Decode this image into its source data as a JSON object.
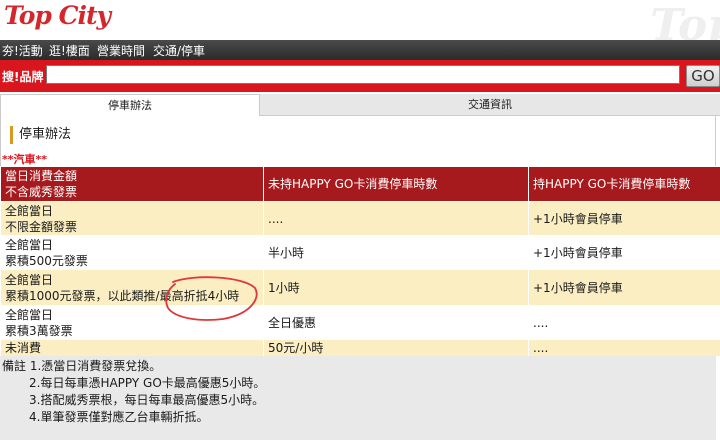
{
  "header": {
    "logo": "Top City",
    "watermark": "Top"
  },
  "nav": {
    "items": [
      "夯!活動",
      "逛!樓面",
      "營業時間",
      "交通/停車"
    ]
  },
  "search": {
    "label": "搜!品牌",
    "value": "",
    "go_label": "GO"
  },
  "tabs": [
    {
      "label": "停車辦法",
      "active": true
    },
    {
      "label": "交通資訊",
      "active": false
    }
  ],
  "section_title": "停車辦法",
  "category": "**汽車**",
  "table": {
    "headers": [
      "當日消費金額\n不含威秀發票",
      "未持HAPPY GO卡消費停車時數",
      "持HAPPY GO卡消費停車時數"
    ],
    "rows": [
      {
        "c1": [
          "全館當日",
          "不限金額發票"
        ],
        "c2": "....",
        "c3": "+1小時會員停車"
      },
      {
        "c1": [
          "全館當日",
          "累積500元發票"
        ],
        "c2": "半小時",
        "c3": "+1小時會員停車"
      },
      {
        "c1": [
          "全館當日",
          "累積1000元發票，以此類推/最高折抵4小時"
        ],
        "c2": "1小時",
        "c3": "+1小時會員停車"
      },
      {
        "c1": [
          "全館當日",
          "累積3萬發票"
        ],
        "c2": "全日優惠",
        "c3": "...."
      },
      {
        "c1": [
          "未消費"
        ],
        "c2": "50元/小時",
        "c3": "...."
      }
    ]
  },
  "notes": [
    "備註 1.憑當日消費發票兌換。",
    "2.每日每車憑HAPPY GO卡最高優惠5小時。",
    "3.搭配威秀票根，每日每車最高優惠5小時。",
    "4.單筆發票僅對應乙台車輛折抵。"
  ],
  "colors": {
    "brand_red": "#d9161d",
    "header_row": "#a61a1d",
    "alt_row": "#fbeec3",
    "annotation": "#e0373a"
  }
}
